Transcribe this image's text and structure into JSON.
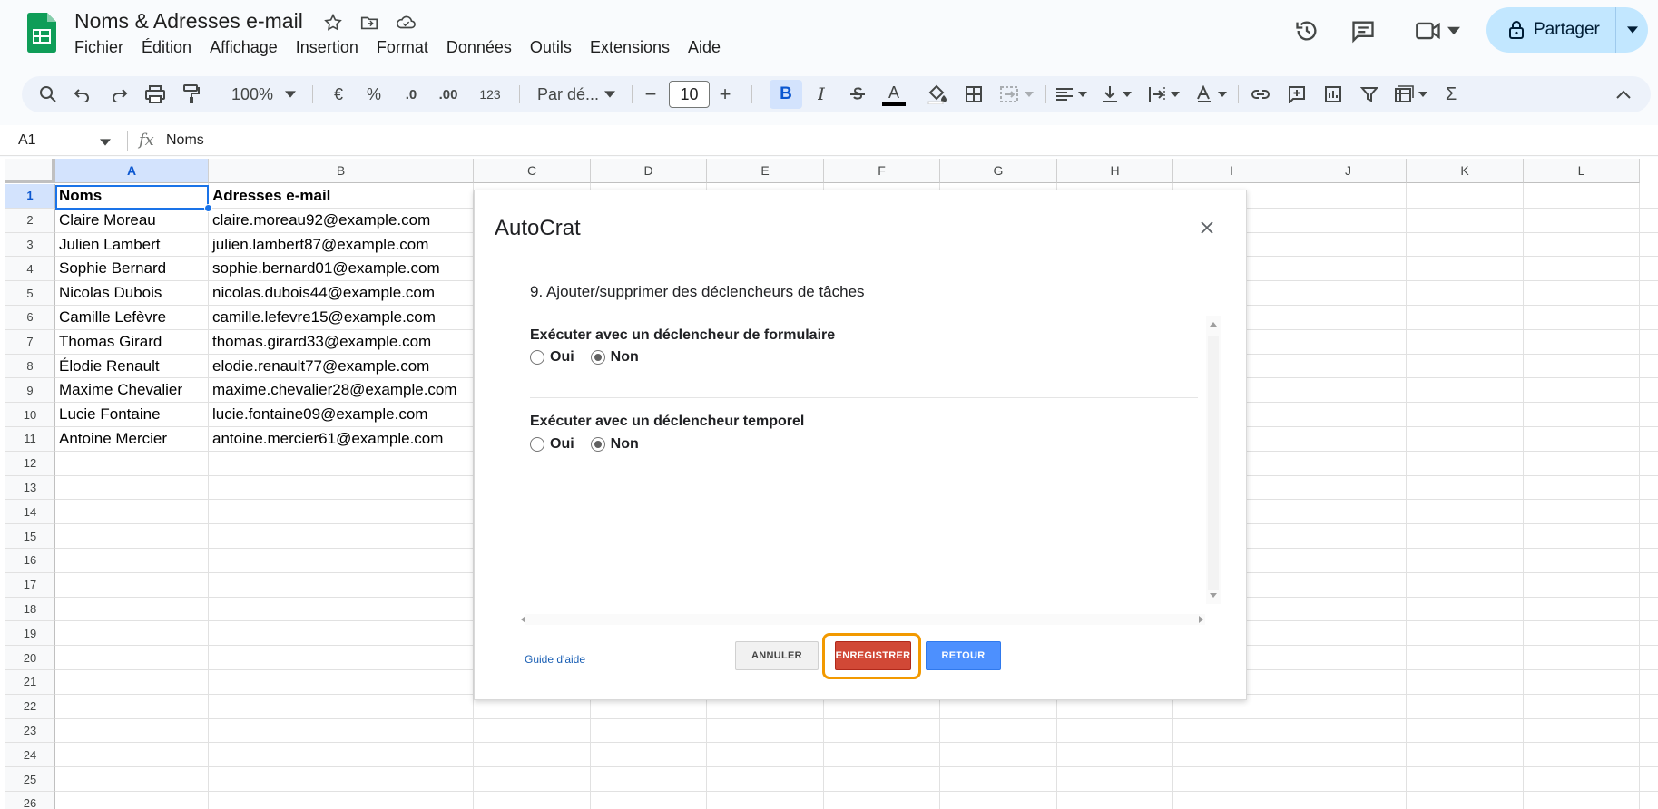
{
  "header": {
    "title": "Noms & Adresses e-mail",
    "menu": [
      "Fichier",
      "Édition",
      "Affichage",
      "Insertion",
      "Format",
      "Données",
      "Outils",
      "Extensions",
      "Aide"
    ],
    "share_label": "Partager"
  },
  "toolbar": {
    "zoom": "100%",
    "currency": "€",
    "percent": "%",
    "decrease_decimals": ".0",
    "increase_decimals": ".00",
    "number_format": "123",
    "font": "Par dé...",
    "font_size": "10",
    "minus": "−",
    "plus": "+",
    "bold": "B",
    "italic": "I",
    "text_color": "A",
    "sum": "Σ"
  },
  "formula_bar": {
    "name_box": "A1",
    "fx": "fx",
    "value": "Noms"
  },
  "grid": {
    "columns": [
      "A",
      "B",
      "C",
      "D",
      "E",
      "F",
      "G",
      "H",
      "I",
      "J",
      "K",
      "L"
    ],
    "rows": [
      "1",
      "2",
      "3",
      "4",
      "5",
      "6",
      "7",
      "8",
      "9",
      "10",
      "11",
      "12",
      "13",
      "14",
      "15",
      "16",
      "17",
      "18",
      "19",
      "20",
      "21",
      "22",
      "23",
      "24",
      "25",
      "26"
    ],
    "data": [
      [
        "Noms",
        "Adresses e-mail"
      ],
      [
        "Claire Moreau",
        "claire.moreau92@example.com"
      ],
      [
        "Julien Lambert",
        "julien.lambert87@example.com"
      ],
      [
        "Sophie Bernard",
        "sophie.bernard01@example.com"
      ],
      [
        "Nicolas Dubois",
        "nicolas.dubois44@example.com"
      ],
      [
        "Camille Lefèvre",
        "camille.lefevre15@example.com"
      ],
      [
        "Thomas Girard",
        "thomas.girard33@example.com"
      ],
      [
        "Élodie Renault",
        "elodie.renault77@example.com"
      ],
      [
        "Maxime Chevalier",
        "maxime.chevalier28@example.com"
      ],
      [
        "Lucie Fontaine",
        "lucie.fontaine09@example.com"
      ],
      [
        "Antoine Mercier",
        "antoine.mercier61@example.com"
      ]
    ]
  },
  "dialog": {
    "title": "AutoCrat",
    "step": "9. Ajouter/supprimer des déclencheurs de tâches",
    "sections": [
      {
        "label": "Exécuter avec un déclencheur de formulaire",
        "yes": "Oui",
        "no": "Non",
        "selected": "Non"
      },
      {
        "label": "Exécuter avec un déclencheur temporel",
        "yes": "Oui",
        "no": "Non",
        "selected": "Non"
      }
    ],
    "help_link": "Guide d'aide",
    "cancel_label": "ANNULER",
    "save_label": "ENREGISTRER",
    "back_label": "RETOUR"
  },
  "colors": {
    "accent": "#1a73e8",
    "save_button": "#d14836",
    "save_highlight": "#f29900",
    "back_button": "#4d90fe",
    "share_bg": "#c2e7ff"
  }
}
